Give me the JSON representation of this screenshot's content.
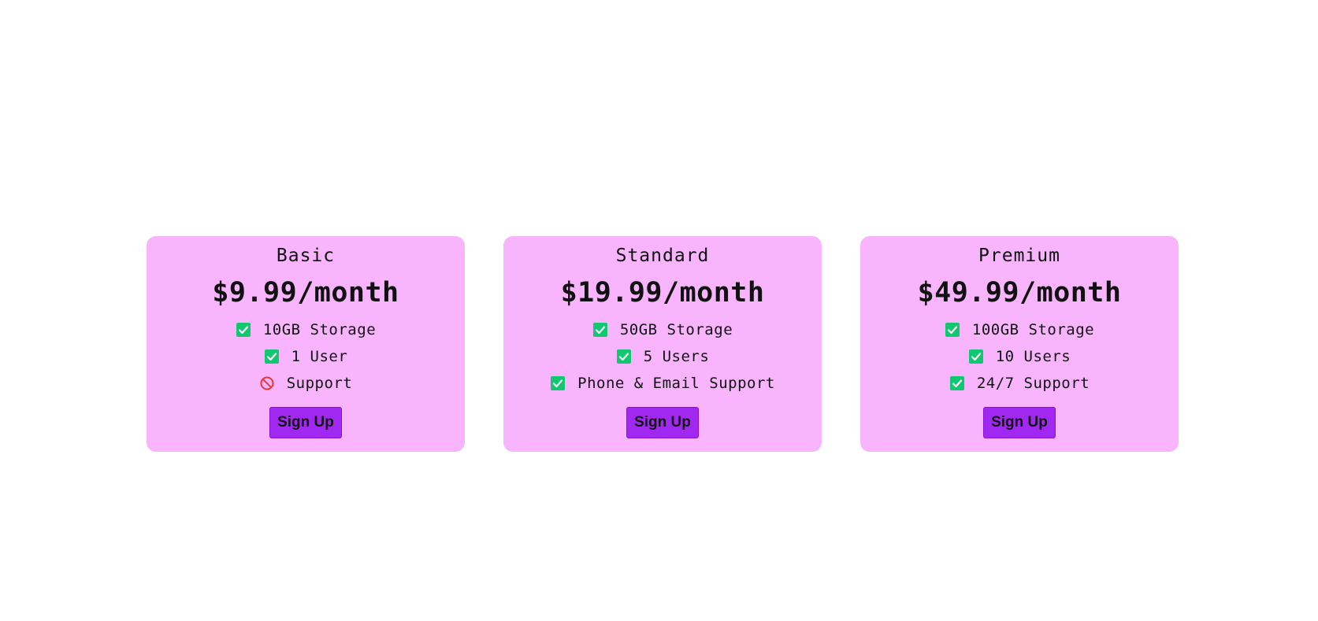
{
  "colors": {
    "card_background": "#f8b4fc",
    "button_background": "#a128f0",
    "check_green": "#11c76f",
    "prohibited_red": "#e53935"
  },
  "plans": [
    {
      "name": "Basic",
      "price": "$9.99/month",
      "features": [
        {
          "icon": "check-icon",
          "text": "10GB Storage"
        },
        {
          "icon": "check-icon",
          "text": "1 User"
        },
        {
          "icon": "prohibited-icon",
          "text": "Support"
        }
      ],
      "button_label": "Sign Up"
    },
    {
      "name": "Standard",
      "price": "$19.99/month",
      "features": [
        {
          "icon": "check-icon",
          "text": "50GB Storage"
        },
        {
          "icon": "check-icon",
          "text": "5 Users"
        },
        {
          "icon": "check-icon",
          "text": "Phone & Email Support"
        }
      ],
      "button_label": "Sign Up"
    },
    {
      "name": "Premium",
      "price": "$49.99/month",
      "features": [
        {
          "icon": "check-icon",
          "text": "100GB Storage"
        },
        {
          "icon": "check-icon",
          "text": "10 Users"
        },
        {
          "icon": "check-icon",
          "text": "24/7 Support"
        }
      ],
      "button_label": "Sign Up"
    }
  ]
}
